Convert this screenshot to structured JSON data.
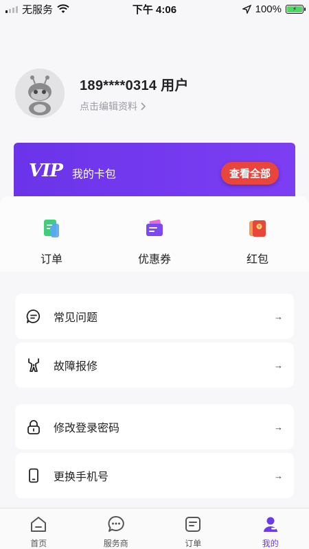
{
  "status_bar": {
    "carrier": "无服务",
    "time": "下午 4:06",
    "battery_percent": "100%",
    "battery_level": 1.0
  },
  "profile": {
    "name": "189****0314 用户",
    "edit_hint": "点击编辑资料"
  },
  "vip": {
    "logo": "VIP",
    "title": "我的卡包",
    "button": "查看全部",
    "colors": {
      "banner": "#7c3ef3",
      "button": "#e8453c"
    }
  },
  "quick_actions": [
    {
      "label": "订单",
      "icon": "order-doc-icon",
      "color": "#3ecf7a"
    },
    {
      "label": "优惠券",
      "icon": "coupon-icon",
      "color": "#7b4bf0"
    },
    {
      "label": "红包",
      "icon": "red-envelope-icon",
      "color": "#e8453c"
    }
  ],
  "menu": [
    {
      "label": "常见问题",
      "icon": "faq-chat-icon",
      "arrow": "→"
    },
    {
      "label": "故障报修",
      "icon": "repair-wrench-icon",
      "arrow": "→"
    },
    {
      "label": "修改登录密码",
      "icon": "lock-icon",
      "arrow": "→"
    },
    {
      "label": "更换手机号",
      "icon": "phone-icon",
      "arrow": "→"
    }
  ],
  "tabbar": {
    "items": [
      {
        "label": "首页",
        "icon": "home-icon"
      },
      {
        "label": "服务商",
        "icon": "chat-bubble-icon"
      },
      {
        "label": "订单",
        "icon": "order-icon"
      },
      {
        "label": "我的",
        "icon": "user-icon"
      }
    ],
    "active_index": 3,
    "accent": "#6c3be8"
  }
}
